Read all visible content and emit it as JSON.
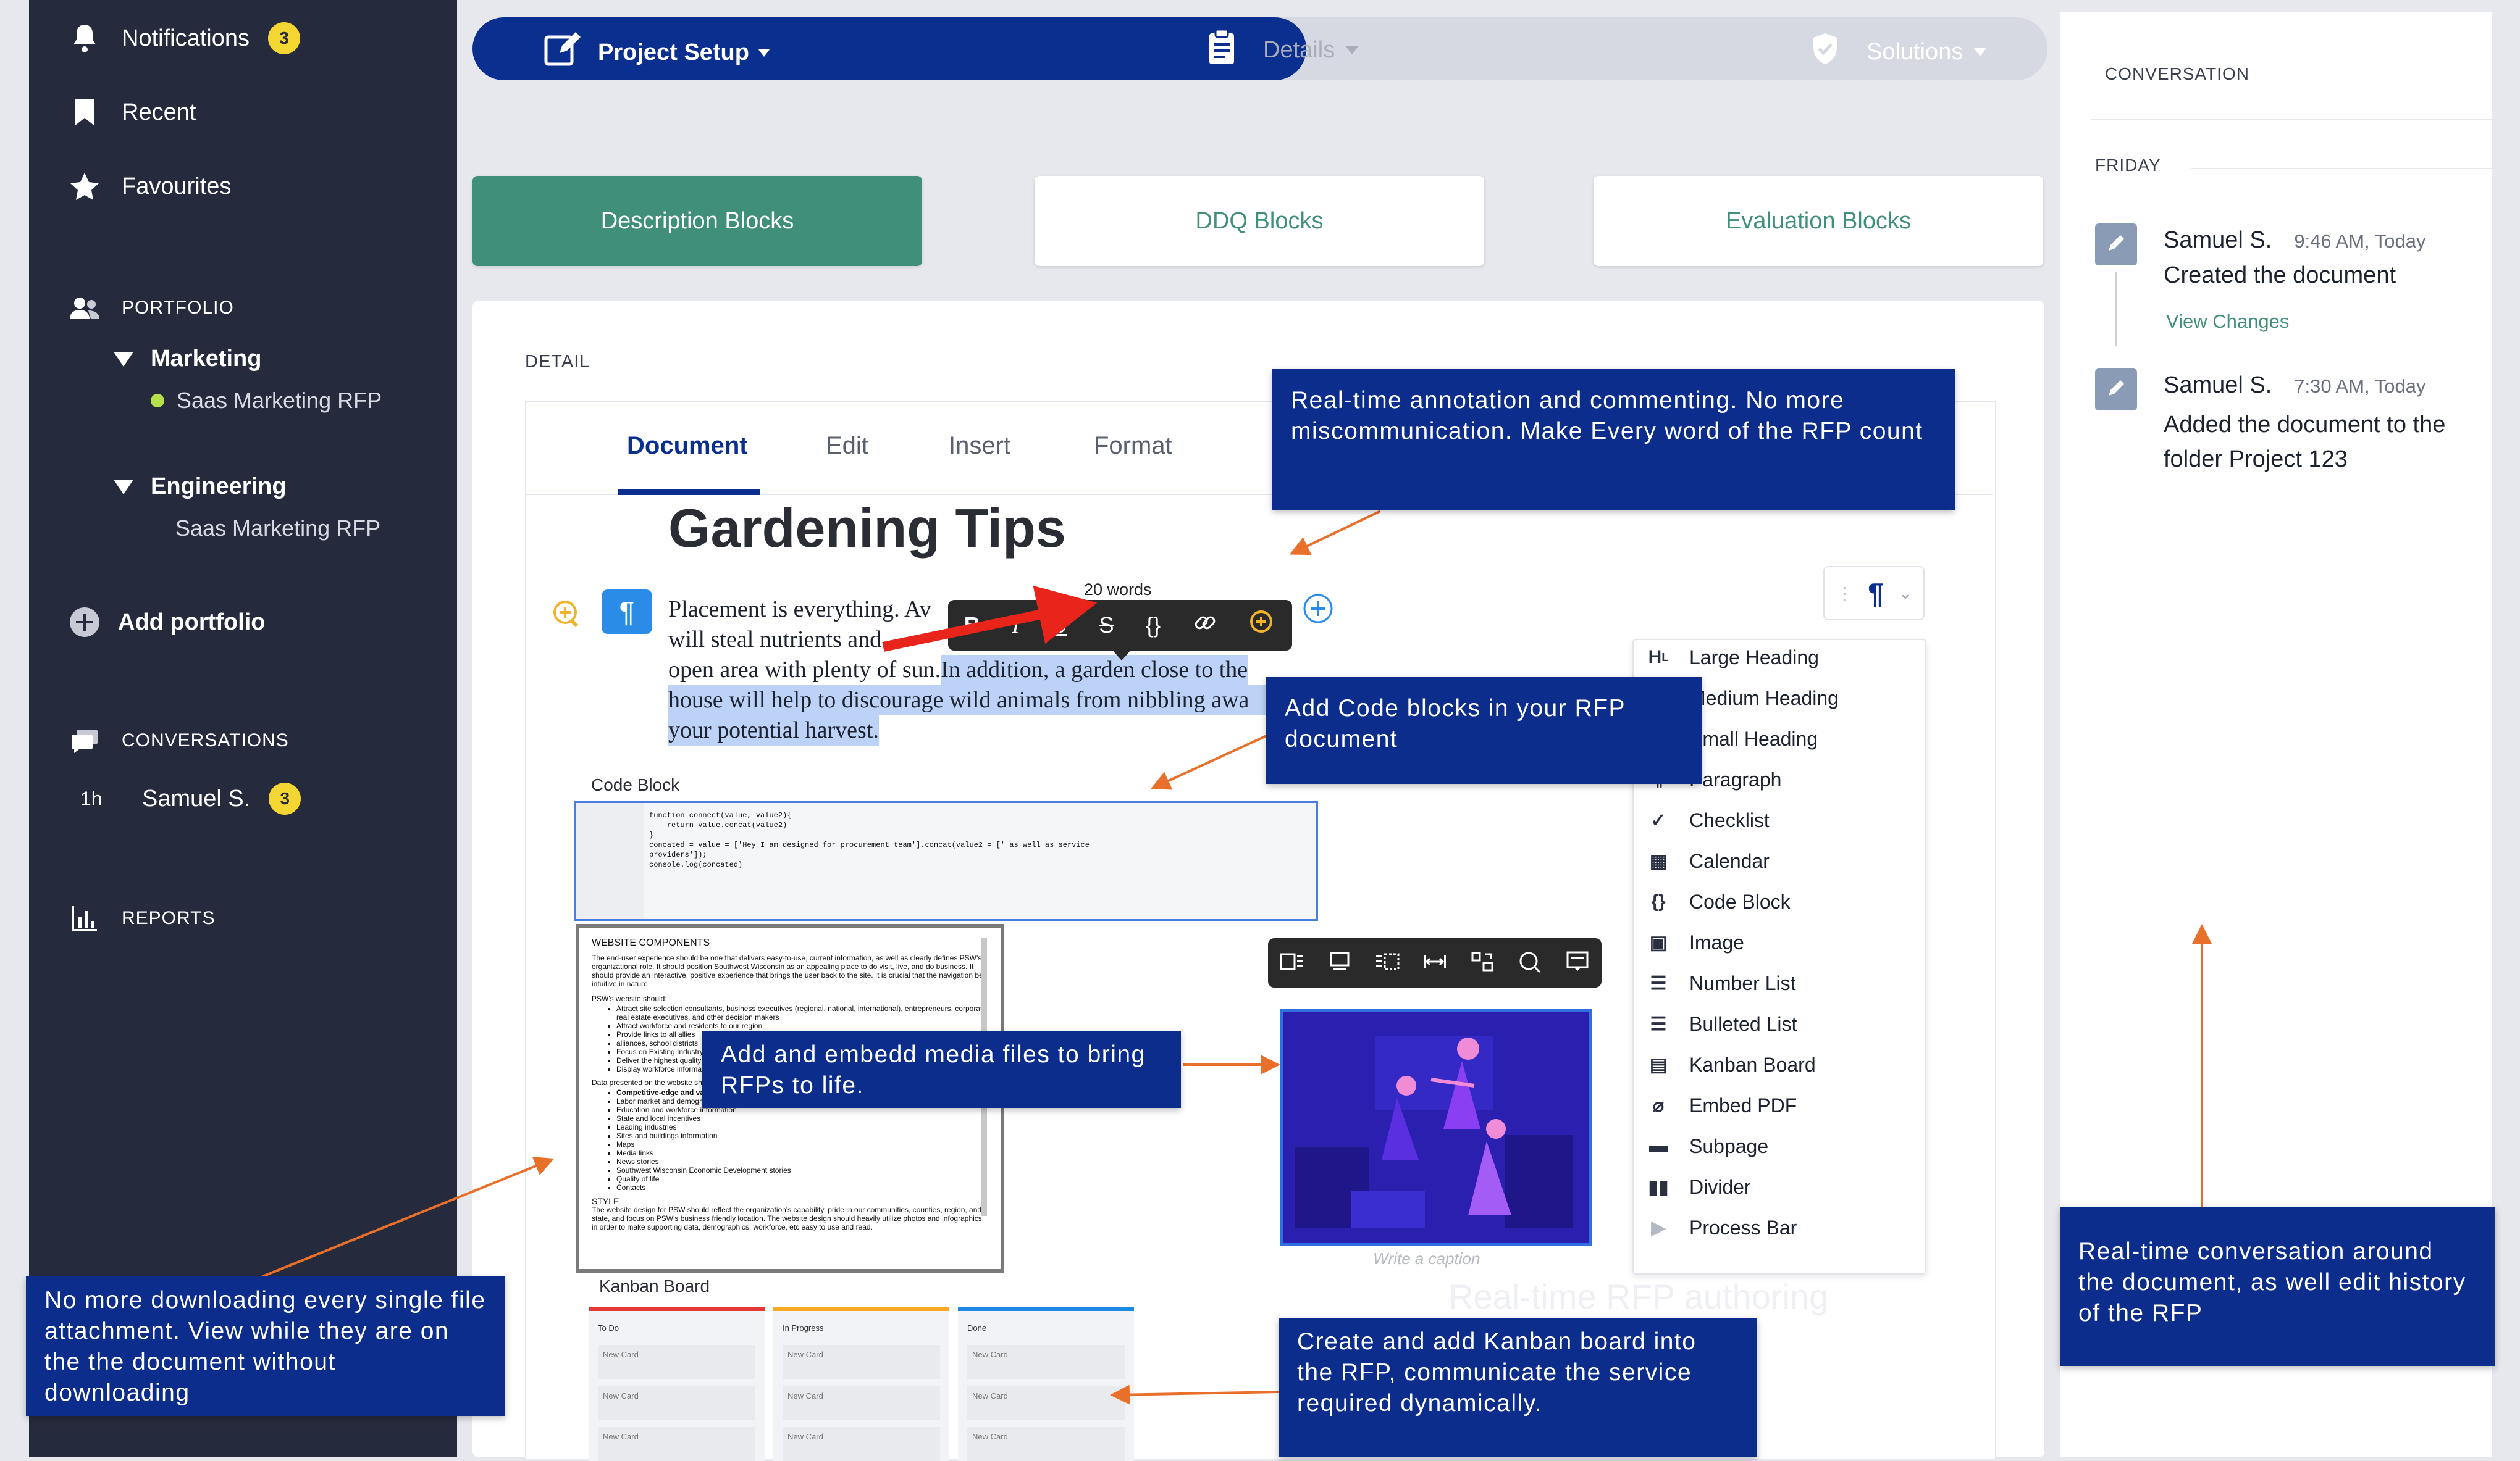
{
  "sidebar": {
    "notifications": {
      "label": "Notifications",
      "count": "3"
    },
    "recent": "Recent",
    "favourites": "Favourites",
    "portfolio_header": "PORTFOLIO",
    "groups": [
      {
        "name": "Marketing",
        "item": "Saas Marketing RFP"
      },
      {
        "name": "Engineering",
        "item": "Saas Marketing RFP"
      }
    ],
    "add_portfolio": "Add portfolio",
    "conversations_header": "CONVERSATIONS",
    "conversation": {
      "time": "1h",
      "name": "Samuel S.",
      "count": "3"
    },
    "reports_header": "REPORTS"
  },
  "topbar": {
    "project_setup": "Project Setup",
    "details": "Details",
    "solutions": "Solutions"
  },
  "categories": [
    "Description Blocks",
    "DDQ  Blocks",
    "Evaluation Blocks"
  ],
  "detail": {
    "header": "DETAIL",
    "tabs": [
      "Document",
      "Edit",
      "Insert",
      "Format"
    ],
    "title": "Gardening Tips",
    "word_count": "20 words",
    "paragraph_lines": [
      "Placement is everything. Av",
      "will steal nutrients and",
      "open area with plenty of sun.",
      " In addition, a garden close to the",
      "house will help to discourage wild animals from nibbling awa",
      "your potential harvest."
    ],
    "code_block_label": "Code Block",
    "code_lines": [
      "function connect(value, value2){",
      "    return value.concat(value2)",
      "}",
      "concated = value = ['Hey I am designed for procurement team'].concat(value2 = [' as well as service",
      "providers']);",
      "console.log(concated)"
    ],
    "embed_doc": {
      "title": "WEBSITE COMPONENTS",
      "intro": "The end-user experience should be one that delivers easy-to-use, current information, as well as clearly defines PSW's organizational role. It should position Southwest Wisconsin as an appealing place to do visit, live, and do business. It should provide an interactive, positive experience that brings the user back to the site. It is crucial that the navigation be intuitive in nature.",
      "should": "PSW's website should:",
      "bullets": [
        "Attract site selection consultants, business executives (regional, national, international), entrepreneurs, corporate real estate executives, and other decision makers",
        "Attract workforce and residents to our region",
        "Provide links to all allies",
        "alliances, school districts",
        "Focus on Existing Industry",
        "Deliver the highest quality",
        "Display workforce informa"
      ],
      "data_intro": "Data presented on the website sho",
      "data_bullets": [
        "Competitive-edge and va",
        "Labor market and demographic statistics",
        "Education and workforce information",
        "State and local incentives",
        "Leading industries",
        "Sites and buildings information",
        "Maps",
        "Media links",
        "News stories",
        "Southwest Wisconsin Economic Development stories",
        "Quality of life",
        "Contacts"
      ],
      "style_header": "STYLE",
      "style_text": "The website design for PSW should reflect the organization's capability, pride in our communities, counties, region, and state, and focus on PSW's business friendly location. The website design should heavily utilize photos and infographics in order to make supporting data, demographics, workforce, etc easy to use and read."
    },
    "caption_placeholder": "Write a caption",
    "kanban": {
      "label": "Kanban Board",
      "columns": [
        {
          "title": "To Do",
          "color": "#e53935",
          "cards": [
            "New Card",
            "New Card",
            "New Card"
          ]
        },
        {
          "title": "In Progress",
          "color": "#f9a825",
          "cards": [
            "New Card",
            "New Card",
            "New Card"
          ]
        },
        {
          "title": "Done",
          "color": "#1e88e5",
          "cards": [
            "New Card",
            "New Card",
            "New Card"
          ]
        }
      ]
    },
    "ghost_text": "Real-time RFP authoring",
    "block_menu": [
      "Large Heading",
      "Medium Heading",
      "Small Heading",
      "Paragraph",
      "Checklist",
      "Calendar",
      "Code Block",
      "Image",
      "Number List",
      "Bulleted List",
      "Kanban Board",
      "Embed PDF",
      "Subpage",
      "Divider",
      "Process Bar"
    ]
  },
  "conversation": {
    "header": "CONVERSATION",
    "day": "FRIDAY",
    "entries": [
      {
        "name": "Samuel S.",
        "time": "9:46 AM, Today",
        "text": "Created the document",
        "link": "View Changes"
      },
      {
        "name": "Samuel S.",
        "time": "7:30 AM, Today",
        "text": "Added the document to the folder Project 123"
      }
    ]
  },
  "callouts": {
    "annotation": "Real-time annotation and commenting. No more miscommunication. Make Every word of the RFP count",
    "code": "Add Code blocks in your RFP document",
    "media": "Add and embedd  media files to bring RFPs to life.",
    "download": "No more downloading every single  file attachment.  View while they are on the the document without downloading",
    "kanban": "Create and add Kanban board into the RFP, communicate the service required dynamically.",
    "conversation": "Real-time conversation around the document, as well edit history of the RFP"
  },
  "colors": {
    "sidebar": "#262a3d",
    "accent_blue": "#0b2f8f",
    "green": "#3f8f7a",
    "badge": "#f3d631",
    "arrow": "#e8702a"
  }
}
